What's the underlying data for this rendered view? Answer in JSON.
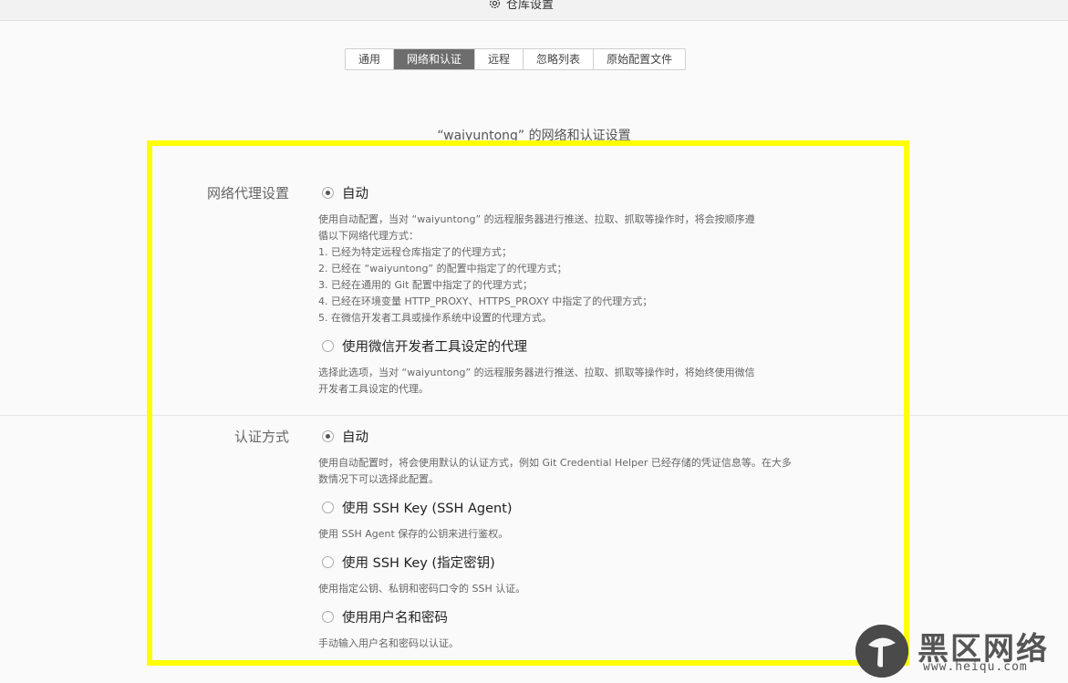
{
  "window": {
    "title": "仓库设置",
    "title_icon": "gear-icon"
  },
  "tabs": [
    {
      "label": "通用",
      "active": false
    },
    {
      "label": "网络和认证",
      "active": true
    },
    {
      "label": "远程",
      "active": false
    },
    {
      "label": "忽略列表",
      "active": false
    },
    {
      "label": "原始配置文件",
      "active": false
    }
  ],
  "heading": "“waiyuntong” 的网络和认证设置",
  "proxy": {
    "section_label": "网络代理设置",
    "options": [
      {
        "label": "自动",
        "checked": true,
        "desc": [
          "使用自动配置，当对 “waiyuntong” 的远程服务器进行推送、拉取、抓取等操作时，将会按顺序遵",
          "循以下网络代理方式：",
          "1. 已经为特定远程仓库指定了的代理方式；",
          "2. 已经在 “waiyuntong” 的配置中指定了的代理方式；",
          "3. 已经在通用的 Git 配置中指定了的代理方式；",
          "4. 已经在环境变量 HTTP_PROXY、HTTPS_PROXY 中指定了的代理方式；",
          "5. 在微信开发者工具或操作系统中设置的代理方式。"
        ]
      },
      {
        "label": "使用微信开发者工具设定的代理",
        "checked": false,
        "desc": [
          "选择此选项，当对 “waiyuntong” 的远程服务器进行推送、拉取、抓取等操作时，将始终使用微信",
          "开发者工具设定的代理。"
        ]
      }
    ]
  },
  "auth": {
    "section_label": "认证方式",
    "options": [
      {
        "label": "自动",
        "checked": true,
        "desc": [
          "使用自动配置时，将会使用默认的认证方式，例如 Git Credential Helper 已经存储的凭证信息等。在大多",
          "数情况下可以选择此配置。"
        ]
      },
      {
        "label": "使用 SSH Key (SSH Agent)",
        "checked": false,
        "desc": [
          "使用 SSH Agent 保存的公钥来进行鉴权。"
        ]
      },
      {
        "label": "使用 SSH Key (指定密钥)",
        "checked": false,
        "desc": [
          "使用指定公钥、私钥和密码口令的 SSH 认证。"
        ]
      },
      {
        "label": "使用用户名和密码",
        "checked": false,
        "desc": [
          "手动输入用户名和密码以认证。"
        ]
      }
    ]
  },
  "highlight_color": "#ffff00",
  "watermark": {
    "text": "黑区网络",
    "url": "www.heiqu.com"
  }
}
